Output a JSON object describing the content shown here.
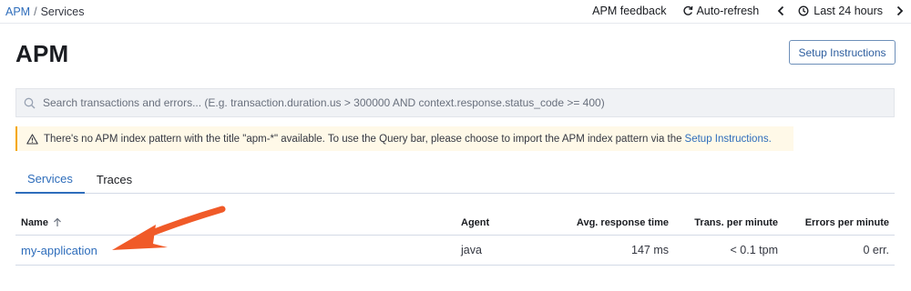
{
  "breadcrumb": {
    "root": "APM",
    "separator": "/",
    "current": "Services"
  },
  "topnav": {
    "feedback": "APM feedback",
    "refresh": "Auto-refresh",
    "time_range": "Last 24 hours",
    "icons": {
      "refresh": "refresh-icon",
      "prev": "chevron-left-icon",
      "clock": "clock-icon",
      "next": "chevron-right-icon"
    }
  },
  "header": {
    "title": "APM",
    "setup_button": "Setup Instructions"
  },
  "search": {
    "placeholder": "Search transactions and errors... (E.g. transaction.duration.us > 300000 AND context.response.status_code >= 400)",
    "value": ""
  },
  "warning": {
    "text": "There's no APM index pattern with the title \"apm-*\" available. To use the Query bar, please choose to import the APM index pattern via the",
    "link": "Setup Instructions.",
    "color": "#f5a700"
  },
  "tabs": [
    {
      "label": "Services",
      "active": true
    },
    {
      "label": "Traces",
      "active": false
    }
  ],
  "table": {
    "columns": {
      "name": "Name",
      "agent": "Agent",
      "response": "Avg. response time",
      "tpm": "Trans. per minute",
      "errors": "Errors per minute"
    },
    "rows": [
      {
        "name": "my-application",
        "agent": "java",
        "response": "147 ms",
        "tpm": "< 0.1 tpm",
        "errors": "0 err."
      }
    ]
  },
  "colors": {
    "link": "#2e6dbb",
    "arrow": "#f05a28",
    "warning_bg": "#fff9e8"
  }
}
